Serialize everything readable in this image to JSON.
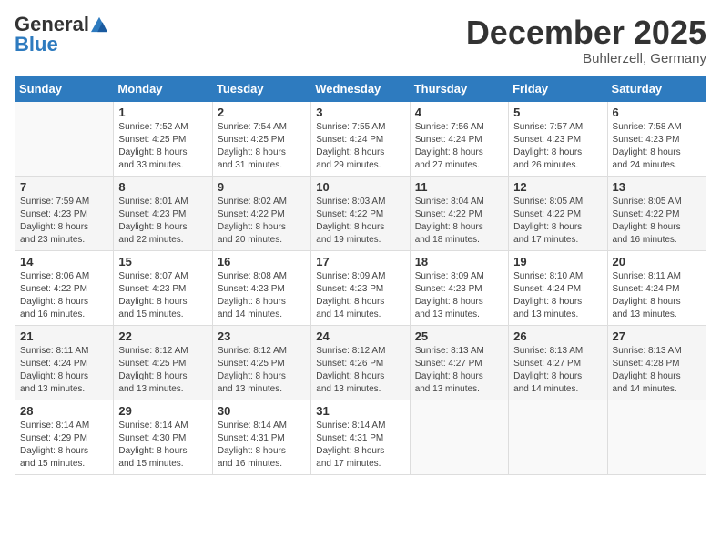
{
  "logo": {
    "general": "General",
    "blue": "Blue"
  },
  "title": "December 2025",
  "location": "Buhlerzell, Germany",
  "days_of_week": [
    "Sunday",
    "Monday",
    "Tuesday",
    "Wednesday",
    "Thursday",
    "Friday",
    "Saturday"
  ],
  "weeks": [
    [
      {
        "day": "",
        "info": ""
      },
      {
        "day": "1",
        "info": "Sunrise: 7:52 AM\nSunset: 4:25 PM\nDaylight: 8 hours\nand 33 minutes."
      },
      {
        "day": "2",
        "info": "Sunrise: 7:54 AM\nSunset: 4:25 PM\nDaylight: 8 hours\nand 31 minutes."
      },
      {
        "day": "3",
        "info": "Sunrise: 7:55 AM\nSunset: 4:24 PM\nDaylight: 8 hours\nand 29 minutes."
      },
      {
        "day": "4",
        "info": "Sunrise: 7:56 AM\nSunset: 4:24 PM\nDaylight: 8 hours\nand 27 minutes."
      },
      {
        "day": "5",
        "info": "Sunrise: 7:57 AM\nSunset: 4:23 PM\nDaylight: 8 hours\nand 26 minutes."
      },
      {
        "day": "6",
        "info": "Sunrise: 7:58 AM\nSunset: 4:23 PM\nDaylight: 8 hours\nand 24 minutes."
      }
    ],
    [
      {
        "day": "7",
        "info": "Sunrise: 7:59 AM\nSunset: 4:23 PM\nDaylight: 8 hours\nand 23 minutes."
      },
      {
        "day": "8",
        "info": "Sunrise: 8:01 AM\nSunset: 4:23 PM\nDaylight: 8 hours\nand 22 minutes."
      },
      {
        "day": "9",
        "info": "Sunrise: 8:02 AM\nSunset: 4:22 PM\nDaylight: 8 hours\nand 20 minutes."
      },
      {
        "day": "10",
        "info": "Sunrise: 8:03 AM\nSunset: 4:22 PM\nDaylight: 8 hours\nand 19 minutes."
      },
      {
        "day": "11",
        "info": "Sunrise: 8:04 AM\nSunset: 4:22 PM\nDaylight: 8 hours\nand 18 minutes."
      },
      {
        "day": "12",
        "info": "Sunrise: 8:05 AM\nSunset: 4:22 PM\nDaylight: 8 hours\nand 17 minutes."
      },
      {
        "day": "13",
        "info": "Sunrise: 8:05 AM\nSunset: 4:22 PM\nDaylight: 8 hours\nand 16 minutes."
      }
    ],
    [
      {
        "day": "14",
        "info": "Sunrise: 8:06 AM\nSunset: 4:22 PM\nDaylight: 8 hours\nand 16 minutes."
      },
      {
        "day": "15",
        "info": "Sunrise: 8:07 AM\nSunset: 4:23 PM\nDaylight: 8 hours\nand 15 minutes."
      },
      {
        "day": "16",
        "info": "Sunrise: 8:08 AM\nSunset: 4:23 PM\nDaylight: 8 hours\nand 14 minutes."
      },
      {
        "day": "17",
        "info": "Sunrise: 8:09 AM\nSunset: 4:23 PM\nDaylight: 8 hours\nand 14 minutes."
      },
      {
        "day": "18",
        "info": "Sunrise: 8:09 AM\nSunset: 4:23 PM\nDaylight: 8 hours\nand 13 minutes."
      },
      {
        "day": "19",
        "info": "Sunrise: 8:10 AM\nSunset: 4:24 PM\nDaylight: 8 hours\nand 13 minutes."
      },
      {
        "day": "20",
        "info": "Sunrise: 8:11 AM\nSunset: 4:24 PM\nDaylight: 8 hours\nand 13 minutes."
      }
    ],
    [
      {
        "day": "21",
        "info": "Sunrise: 8:11 AM\nSunset: 4:24 PM\nDaylight: 8 hours\nand 13 minutes."
      },
      {
        "day": "22",
        "info": "Sunrise: 8:12 AM\nSunset: 4:25 PM\nDaylight: 8 hours\nand 13 minutes."
      },
      {
        "day": "23",
        "info": "Sunrise: 8:12 AM\nSunset: 4:25 PM\nDaylight: 8 hours\nand 13 minutes."
      },
      {
        "day": "24",
        "info": "Sunrise: 8:12 AM\nSunset: 4:26 PM\nDaylight: 8 hours\nand 13 minutes."
      },
      {
        "day": "25",
        "info": "Sunrise: 8:13 AM\nSunset: 4:27 PM\nDaylight: 8 hours\nand 13 minutes."
      },
      {
        "day": "26",
        "info": "Sunrise: 8:13 AM\nSunset: 4:27 PM\nDaylight: 8 hours\nand 14 minutes."
      },
      {
        "day": "27",
        "info": "Sunrise: 8:13 AM\nSunset: 4:28 PM\nDaylight: 8 hours\nand 14 minutes."
      }
    ],
    [
      {
        "day": "28",
        "info": "Sunrise: 8:14 AM\nSunset: 4:29 PM\nDaylight: 8 hours\nand 15 minutes."
      },
      {
        "day": "29",
        "info": "Sunrise: 8:14 AM\nSunset: 4:30 PM\nDaylight: 8 hours\nand 15 minutes."
      },
      {
        "day": "30",
        "info": "Sunrise: 8:14 AM\nSunset: 4:31 PM\nDaylight: 8 hours\nand 16 minutes."
      },
      {
        "day": "31",
        "info": "Sunrise: 8:14 AM\nSunset: 4:31 PM\nDaylight: 8 hours\nand 17 minutes."
      },
      {
        "day": "",
        "info": ""
      },
      {
        "day": "",
        "info": ""
      },
      {
        "day": "",
        "info": ""
      }
    ]
  ]
}
